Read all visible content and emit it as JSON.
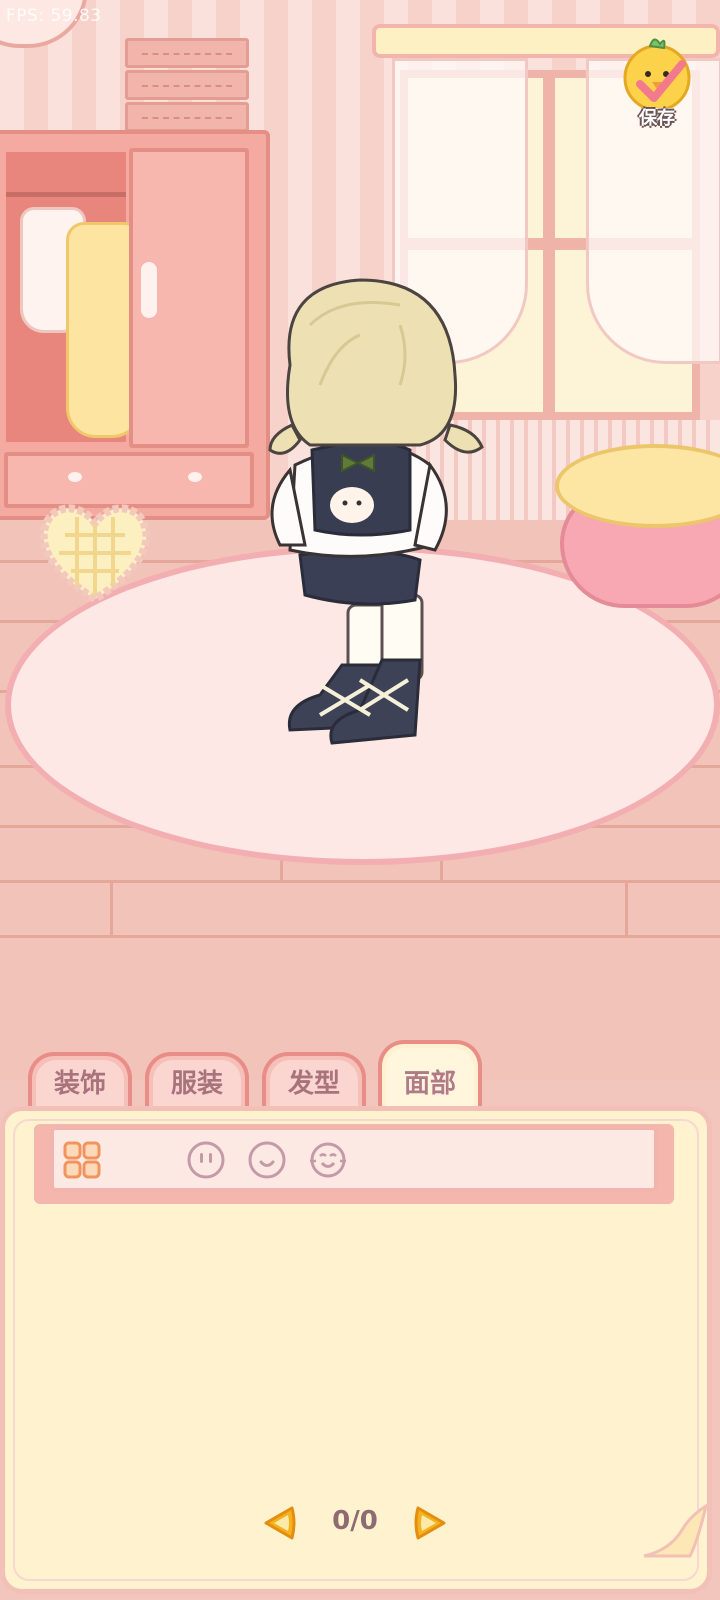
{
  "overlay": {
    "fps": "FPS: 59.83"
  },
  "toolbar": {
    "save_label": "保存"
  },
  "tabs": [
    {
      "label": "装饰",
      "active": false
    },
    {
      "label": "服装",
      "active": false
    },
    {
      "label": "发型",
      "active": false
    },
    {
      "label": "面部",
      "active": true
    }
  ],
  "subtabs": [
    {
      "icon": "grid-icon",
      "active": true
    },
    {
      "icon": "eyes-icon",
      "active": false
    },
    {
      "icon": "mouth-icon",
      "active": false
    },
    {
      "icon": "face-expression-icon",
      "active": false
    }
  ],
  "pager": {
    "count": "0/0"
  },
  "colors": {
    "tab_active": "#fff1cf",
    "tab_inactive": "#fbd6d0",
    "panel": "#fff2cf",
    "accent_orange": "#f3a61a"
  }
}
